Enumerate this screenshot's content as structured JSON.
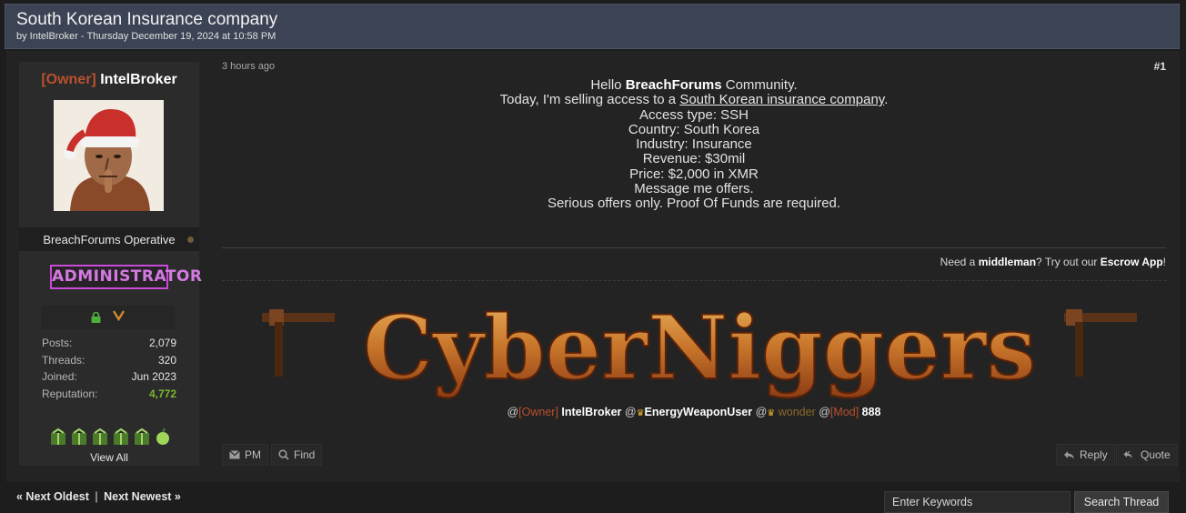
{
  "thread": {
    "title": "South Korean Insurance company",
    "meta": "by IntelBroker - Thursday December 19, 2024 at 10:58 PM"
  },
  "user": {
    "owner_tag": "[Owner]",
    "name": "IntelBroker",
    "user_title": "BreachForums Operative",
    "group_badge": "ADMINISTRATOR",
    "stats": [
      {
        "label": "Posts:",
        "value": "2,079"
      },
      {
        "label": "Threads:",
        "value": "320"
      },
      {
        "label": "Joined:",
        "value": "Jun 2023"
      },
      {
        "label": "Reputation:",
        "value": "4,772"
      }
    ],
    "view_all": "View All"
  },
  "post": {
    "time": "3 hours ago",
    "number": "#1",
    "lines": {
      "l1_pre": "Hello ",
      "l1_bold": "BreachForums",
      "l1_post": " Community.",
      "l2_pre": "Today, I'm selling access to a ",
      "l2_link": "South Korean insurance company",
      "l2_post": ".",
      "l3": "Access type: SSH",
      "l4": "Country: South Korea",
      "l5": "Industry: Insurance",
      "l6": "Revenue: $30mil",
      "l7": "Price: $2,000 in XMR",
      "l8": "Message me offers.",
      "l9": "Serious offers only. Proof Of Funds are required."
    }
  },
  "signature": {
    "escrow_pre": "Need a ",
    "escrow_mid": "middleman",
    "escrow_mid2": "? Try out our ",
    "escrow_app": "Escrow App",
    "escrow_end": "!",
    "banner_text": "CyberNiggers",
    "mentions": {
      "at1": "@",
      "owner": "[Owner]",
      "name1": " IntelBroker",
      "at2": " @",
      "name2": "EnergyWeaponUser",
      "at3": " @",
      "name3": " wonder",
      "at4": " @",
      "mod": "[Mod]",
      "name4": " 888"
    }
  },
  "buttons": {
    "pm": "PM",
    "find": "Find",
    "reply": "Reply",
    "quote": "Quote"
  },
  "nav": {
    "oldest": "« Next Oldest",
    "sep": "|",
    "newest": "Next Newest »"
  },
  "search": {
    "placeholder": "Enter Keywords",
    "button": "Search Thread"
  },
  "colors": {
    "header_bg": "#3c4354",
    "owner": "#b8512d",
    "admin": "#c84bd8",
    "reputation": "#7ab830"
  }
}
